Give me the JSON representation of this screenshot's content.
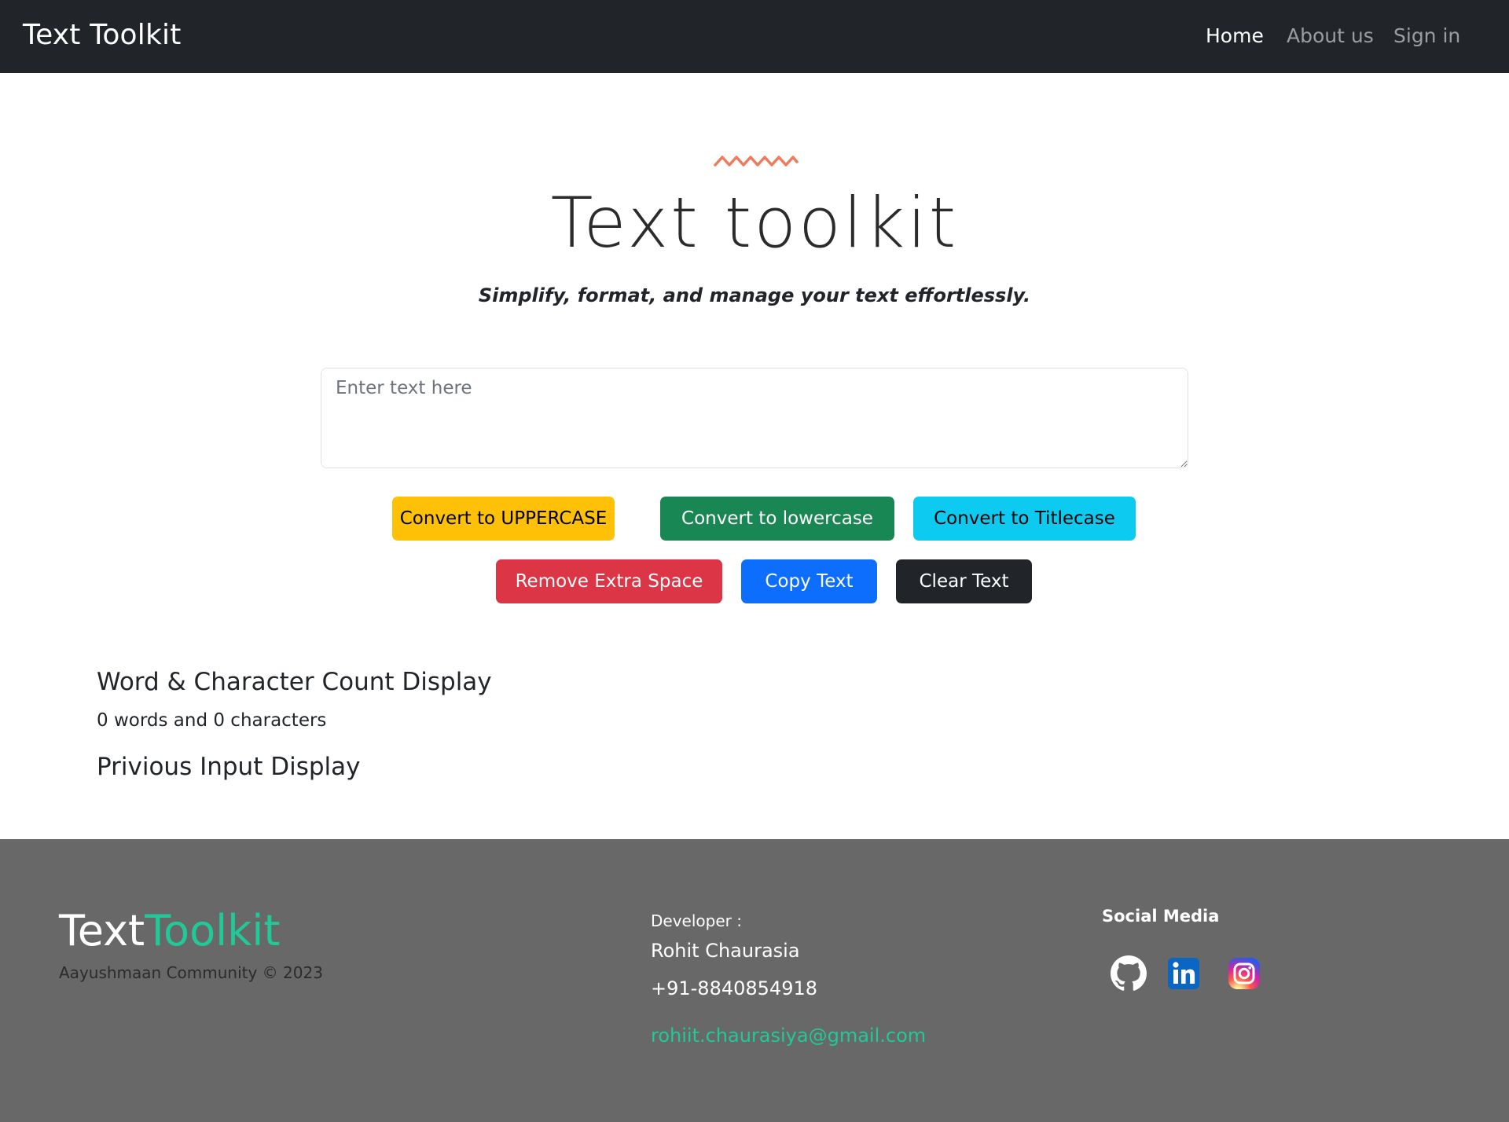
{
  "navbar": {
    "brand": "Text Toolkit",
    "links": [
      {
        "label": "Home",
        "active": true
      },
      {
        "label": "About us",
        "active": false
      },
      {
        "label": "Sign in",
        "active": false
      }
    ]
  },
  "hero": {
    "decoration_icon": "squiggle-icon",
    "title": "Text toolkit",
    "subtitle": "Simplify, format, and manage your text effortlessly."
  },
  "input": {
    "placeholder": "Enter text here",
    "value": ""
  },
  "buttons": {
    "uppercase": "Convert to UPPERCASE",
    "lowercase": "Convert to lowercase",
    "titlecase": "Convert to Titlecase",
    "remove_space": "Remove Extra Space",
    "copy": "Copy Text",
    "clear": "Clear Text"
  },
  "summary": {
    "heading": "Word & Character Count Display",
    "count_text": "0 words and 0 characters",
    "previous_heading": "Privious Input Display"
  },
  "footer": {
    "logo_part1": "Text",
    "logo_part2": "Toolkit",
    "copyright": "Aayushmaan Community © 2023",
    "developer_label": "Developer :",
    "developer_name": "Rohit Chaurasia",
    "phone": "+91-8840854918",
    "email": "rohiit.chaurasiya@gmail.com",
    "social_heading": "Social Media",
    "social_icons": [
      "github-icon",
      "linkedin-icon",
      "instagram-icon"
    ]
  },
  "colors": {
    "navbar_bg": "#212529",
    "footer_bg": "#686868",
    "accent_teal": "#20c997",
    "squiggle": "#f07a5e",
    "btn_warning": "#ffc107",
    "btn_success": "#198754",
    "btn_info": "#0dcaf0",
    "btn_danger": "#dc3545",
    "btn_primary": "#0d6efd",
    "btn_dark": "#212529"
  }
}
